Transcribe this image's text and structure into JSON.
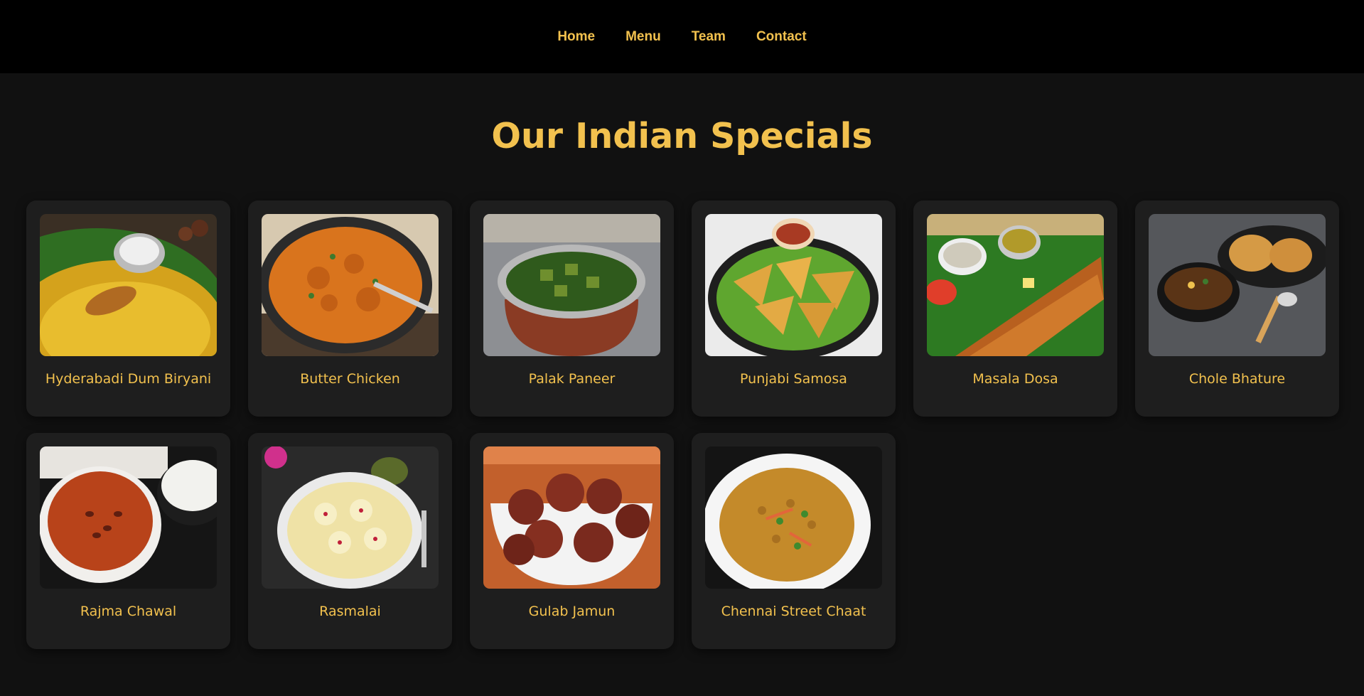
{
  "nav": {
    "items": [
      {
        "label": "Home"
      },
      {
        "label": "Menu"
      },
      {
        "label": "Team"
      },
      {
        "label": "Contact"
      }
    ]
  },
  "page": {
    "title": "Our Indian Specials"
  },
  "dishes": [
    {
      "name": "Hyderabadi Dum Biryani"
    },
    {
      "name": "Butter Chicken"
    },
    {
      "name": "Palak Paneer"
    },
    {
      "name": "Punjabi Samosa"
    },
    {
      "name": "Masala Dosa"
    },
    {
      "name": "Chole Bhature"
    },
    {
      "name": "Rajma Chawal"
    },
    {
      "name": "Rasmalai"
    },
    {
      "name": "Gulab Jamun"
    },
    {
      "name": "Chennai Street Chaat"
    }
  ],
  "colors": {
    "accent": "#f2c14e",
    "background": "#111111",
    "nav_background": "#000000",
    "card": "#1e1e1e"
  }
}
